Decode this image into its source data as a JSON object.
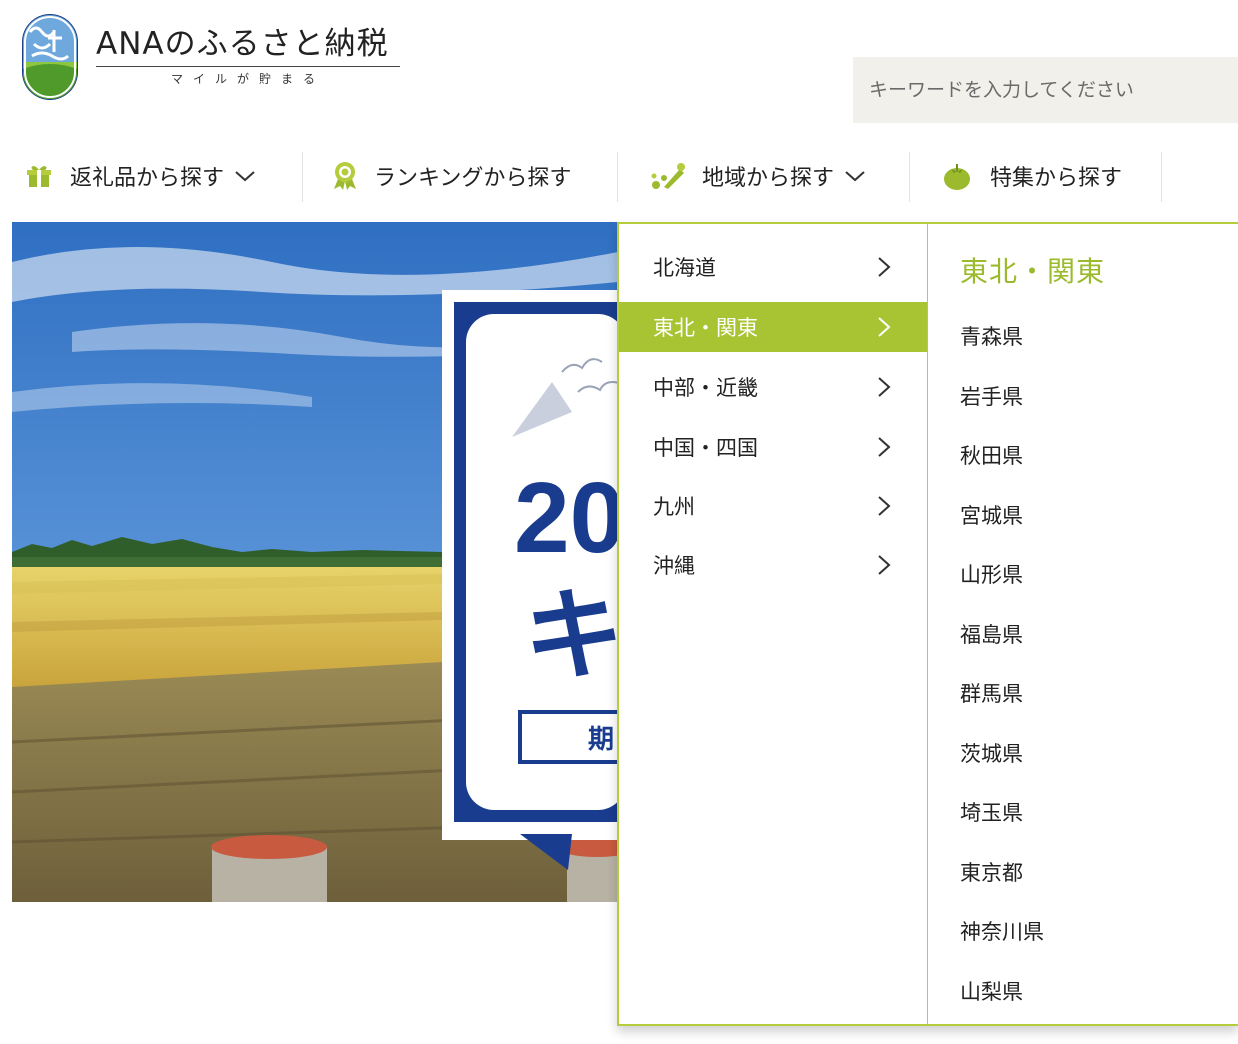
{
  "header": {
    "logo_title": "ANAのふるさと納税",
    "logo_subtitle": "マイルが貯まる",
    "search": {
      "placeholder": "キーワードを入力してください"
    }
  },
  "nav": {
    "items": [
      {
        "label": "返礼品から探す",
        "icon": "gift-icon",
        "has_dropdown": true
      },
      {
        "label": "ランキングから探す",
        "icon": "ranking-medal-icon",
        "has_dropdown": false
      },
      {
        "label": "地域から探す",
        "icon": "map-pin-icon",
        "has_dropdown": true
      },
      {
        "label": "特集から探す",
        "icon": "tomato-icon",
        "has_dropdown": false
      }
    ]
  },
  "hero": {
    "banner_visible_text": [
      "20",
      "キ",
      "期"
    ]
  },
  "menu": {
    "regions": [
      {
        "label": "北海道",
        "active": false
      },
      {
        "label": "東北・関東",
        "active": true
      },
      {
        "label": "中部・近畿",
        "active": false
      },
      {
        "label": "中国・四国",
        "active": false
      },
      {
        "label": "九州",
        "active": false
      },
      {
        "label": "沖縄",
        "active": false
      }
    ],
    "selected_region_heading": "東北・関東",
    "prefectures": [
      "青森県",
      "岩手県",
      "秋田県",
      "宮城県",
      "山形県",
      "福島県",
      "群馬県",
      "茨城県",
      "埼玉県",
      "東京都",
      "神奈川県",
      "山梨県"
    ]
  },
  "colors": {
    "accent_green": "#a9c433",
    "heading_green": "#9cba2d",
    "navy": "#1e3a8a",
    "search_bg": "#f2f0ea"
  }
}
